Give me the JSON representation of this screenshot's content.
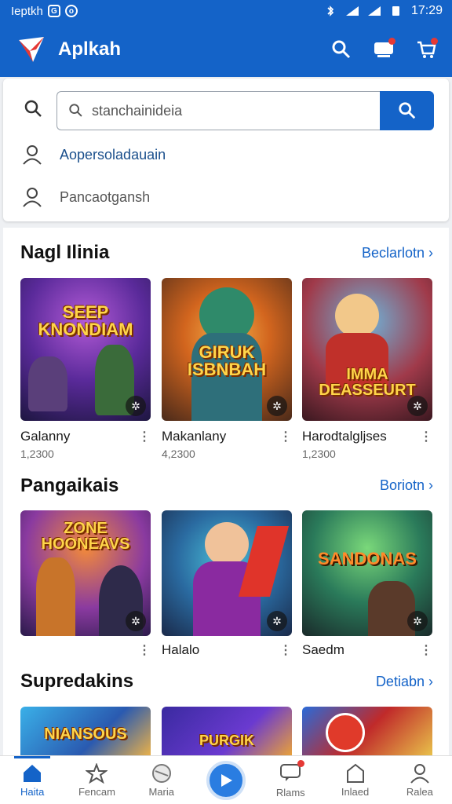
{
  "status_bar": {
    "carrier": "Ieptkh",
    "time": "17:29"
  },
  "app_bar": {
    "title": "Aplkah"
  },
  "search": {
    "placeholder": "stanchainideia"
  },
  "suggestions": [
    "Aopersoladauain",
    "Pancaotgansh"
  ],
  "sections": [
    {
      "title": "Nagl Ilinia",
      "link": "Beclarlotn",
      "cards": [
        {
          "art": "SEEP KNONDIAM",
          "name": "Galanny",
          "count": "1,2300"
        },
        {
          "art": "GIRUK ISBNBAH",
          "name": "Makanlany",
          "count": "4,2300"
        },
        {
          "art": "IMMA DEASSEURT",
          "name": "Harodtalgljses",
          "count": "1,2300"
        }
      ]
    },
    {
      "title": "Pangaikais",
      "link": "Boriotn",
      "cards": [
        {
          "art": "ZONE HOONEAVS",
          "name": "",
          "count": ""
        },
        {
          "art": "",
          "name": "Halalo",
          "count": ""
        },
        {
          "art": "SANDONAS",
          "name": "Saedm",
          "count": ""
        }
      ]
    },
    {
      "title": "Supredakins",
      "link": "Detiabn",
      "cards": [
        {
          "art": "NIANSOUS"
        },
        {
          "art": "PURGIK"
        },
        {
          "art": ""
        }
      ]
    }
  ],
  "bottom_nav": [
    {
      "label": "Haita",
      "icon": "home-icon"
    },
    {
      "label": "Fencam",
      "icon": "star-icon"
    },
    {
      "label": "Maria",
      "icon": "globe-icon"
    },
    {
      "label": "",
      "icon": "play-icon"
    },
    {
      "label": "Rlams",
      "icon": "chat-icon"
    },
    {
      "label": "Inlaed",
      "icon": "bag-icon"
    },
    {
      "label": "Ralea",
      "icon": "profile-icon"
    }
  ],
  "colors": {
    "primary": "#1463c8",
    "accent_red": "#e53935"
  }
}
